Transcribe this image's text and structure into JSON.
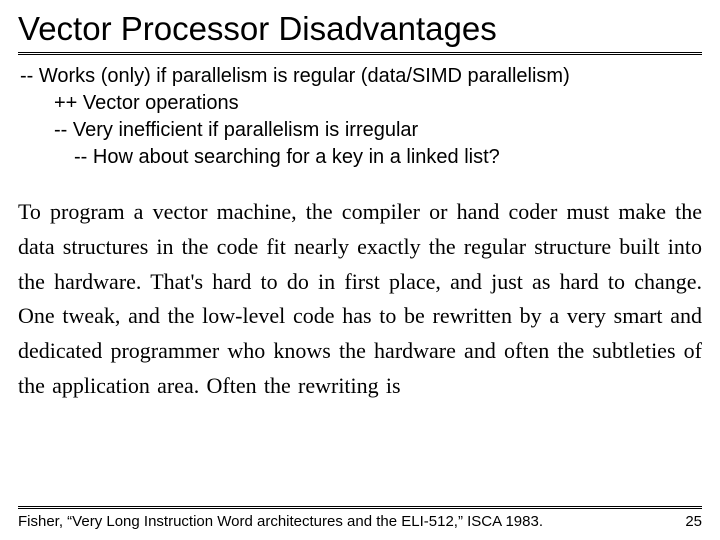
{
  "title": "Vector Processor Disadvantages",
  "bullets": {
    "b1": "-- Works (only) if parallelism is regular (data/SIMD parallelism)",
    "b2a": "++ Vector operations",
    "b2b": "-- Very inefficient if parallelism is irregular",
    "b3": "-- How about searching for a key in a linked list?"
  },
  "quote": "To program a vector machine, the compiler or hand coder must make the data structures in the code fit nearly exactly the regular structure built into the hardware. That's hard to do in first place, and just as hard to change. One tweak, and the low-level code has to be rewritten by a very smart and dedicated programmer who knows the hardware and often the subtleties of the application area. Often the rewriting is",
  "citation": "Fisher, “Very Long Instruction Word architectures and the ELI-512,” ISCA 1983.",
  "page": "25"
}
